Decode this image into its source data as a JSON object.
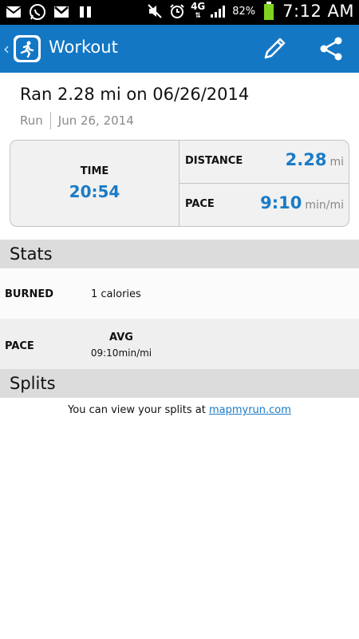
{
  "status_bar": {
    "battery_pct": "82%",
    "time": "7:12 AM",
    "network": "4G",
    "icons": [
      "mail-icon",
      "whatsapp-icon",
      "gmail-icon",
      "pause-icon",
      "mute-icon",
      "alarm-icon",
      "network-4g-icon",
      "signal-icon",
      "battery-icon"
    ]
  },
  "action_bar": {
    "title": "Workout",
    "back_glyph": "‹",
    "accent": "#1377c4"
  },
  "workout": {
    "title": "Ran 2.28 mi on 06/26/2014",
    "activity_type": "Run",
    "date": "Jun 26, 2014"
  },
  "summary": {
    "time_label": "TIME",
    "time_value": "20:54",
    "distance_label": "DISTANCE",
    "distance_value": "2.28",
    "distance_unit": "mi",
    "pace_label": "PACE",
    "pace_value": "9:10",
    "pace_unit": "min/mi",
    "value_color": "#1a7bc7"
  },
  "stats": {
    "header": "Stats",
    "burned_label": "BURNED",
    "burned_value": "1 calories",
    "pace_label": "PACE",
    "avg_label": "AVG",
    "avg_value": "09:10min/mi"
  },
  "splits": {
    "header": "Splits",
    "text": "You can view your splits at",
    "link": "mapmyrun.com"
  }
}
